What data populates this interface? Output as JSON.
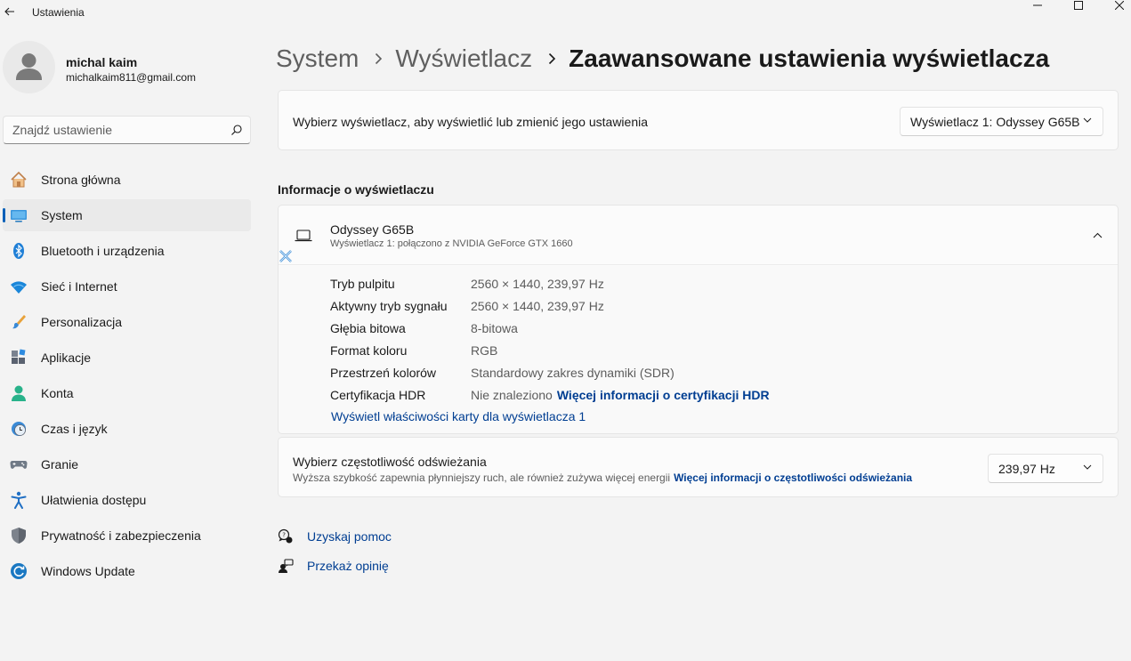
{
  "window": {
    "title": "Ustawienia"
  },
  "profile": {
    "name": "michal kaim",
    "email": "michalkaim811@gmail.com"
  },
  "search": {
    "placeholder": "Znajdź ustawienie"
  },
  "sidebar": {
    "items": [
      {
        "label": "Strona główna",
        "icon": "home-icon",
        "active": false
      },
      {
        "label": "System",
        "icon": "system-icon",
        "active": true
      },
      {
        "label": "Bluetooth i urządzenia",
        "icon": "bluetooth-icon",
        "active": false
      },
      {
        "label": "Sieć i Internet",
        "icon": "wifi-icon",
        "active": false
      },
      {
        "label": "Personalizacja",
        "icon": "brush-icon",
        "active": false
      },
      {
        "label": "Aplikacje",
        "icon": "apps-icon",
        "active": false
      },
      {
        "label": "Konta",
        "icon": "account-icon",
        "active": false
      },
      {
        "label": "Czas i język",
        "icon": "time-language-icon",
        "active": false
      },
      {
        "label": "Granie",
        "icon": "gamepad-icon",
        "active": false
      },
      {
        "label": "Ułatwienia dostępu",
        "icon": "accessibility-icon",
        "active": false
      },
      {
        "label": "Prywatność i zabezpieczenia",
        "icon": "shield-icon",
        "active": false
      },
      {
        "label": "Windows Update",
        "icon": "update-icon",
        "active": false
      }
    ]
  },
  "breadcrumb": {
    "level1": "System",
    "level2": "Wyświetlacz",
    "current": "Zaawansowane ustawienia wyświetlacza"
  },
  "display_select": {
    "label": "Wybierz wyświetlacz, aby wyświetlić lub zmienić jego ustawienia",
    "selected": "Wyświetlacz 1: Odyssey G65B"
  },
  "info_section": {
    "title": "Informacje o wyświetlaczu",
    "monitor_name": "Odyssey G65B",
    "monitor_subtitle": "Wyświetlacz 1: połączono z NVIDIA GeForce GTX 1660",
    "rows": [
      {
        "key": "Tryb pulpitu",
        "value": "2560 × 1440, 239,97 Hz"
      },
      {
        "key": "Aktywny tryb sygnału",
        "value": "2560 × 1440, 239,97 Hz"
      },
      {
        "key": "Głębia bitowa",
        "value": "8-bitowa"
      },
      {
        "key": "Format koloru",
        "value": "RGB"
      },
      {
        "key": "Przestrzeń kolorów",
        "value": "Standardowy zakres dynamiki (SDR)"
      },
      {
        "key": "Certyfikacja HDR",
        "value": "Nie znaleziono",
        "link": "Więcej informacji o certyfikacji HDR"
      }
    ],
    "adapter_link": "Wyświetl właściwości karty dla wyświetlacza 1"
  },
  "refresh": {
    "title": "Wybierz częstotliwość odświeżania",
    "description": "Wyższa szybkość zapewnia płynniejszy ruch, ale również zużywa więcej energii",
    "link": "Więcej informacji o częstotliwości odświeżania",
    "selected": "239,97 Hz"
  },
  "help": {
    "get_help": "Uzyskaj pomoc",
    "feedback": "Przekaż opinię"
  },
  "colors": {
    "accent": "#005fb8",
    "link": "#003e92",
    "background": "#f3f3f3",
    "card": "#fbfbfb"
  }
}
